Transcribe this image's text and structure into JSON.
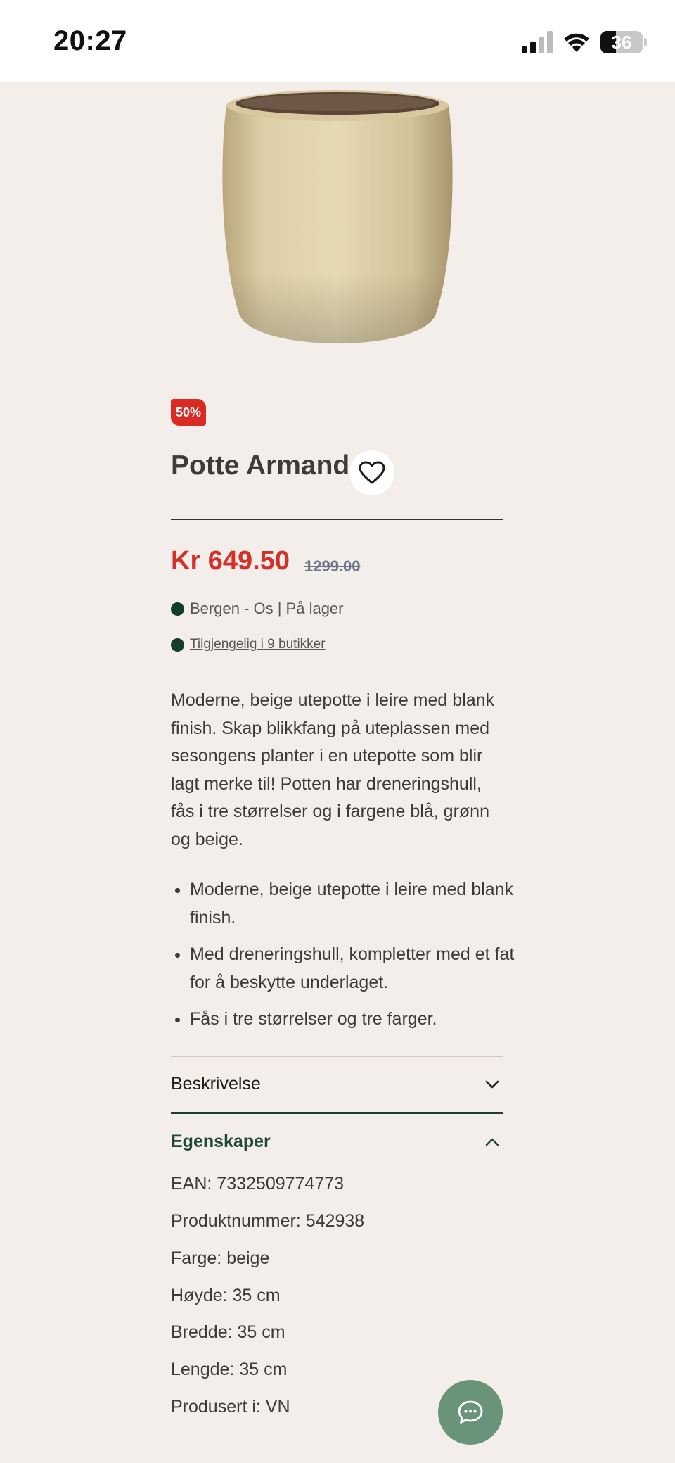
{
  "status_bar": {
    "time": "20:27",
    "battery": "36"
  },
  "product": {
    "discount_badge": "50%",
    "title": "Potte Armand",
    "price": "Kr 649.50",
    "old_price": "1299.00",
    "stock_location": "Bergen - Os | På lager",
    "availability_link": "Tilgjengelig i 9 butikker",
    "description": "Moderne, beige utepotte i leire med blank finish. Skap blikkfang på uteplassen med sesongens planter i en utepotte som blir lagt merke til! Potten har dreneringshull, fås i tre størrelser og i fargene blå, grønn og beige.",
    "bullets": [
      "Moderne, beige utepotte i leire med blank finish.",
      "Med dreneringshull, kompletter med et fat for å beskytte underlaget.",
      "Fås i tre størrelser og tre farger."
    ]
  },
  "accordion": {
    "description_label": "Beskrivelse",
    "properties_label": "Egenskaper",
    "properties": [
      "EAN: 7332509774773",
      "Produktnummer: 542938",
      "Farge: beige",
      "Høyde: 35 cm",
      "Bredde: 35 cm",
      "Lengde: 35 cm",
      "Produsert i: VN"
    ]
  },
  "colors": {
    "accent": "#d6302a",
    "brand_green": "#1f4a35",
    "background": "#f3eeea",
    "chat": "#6a9479"
  }
}
